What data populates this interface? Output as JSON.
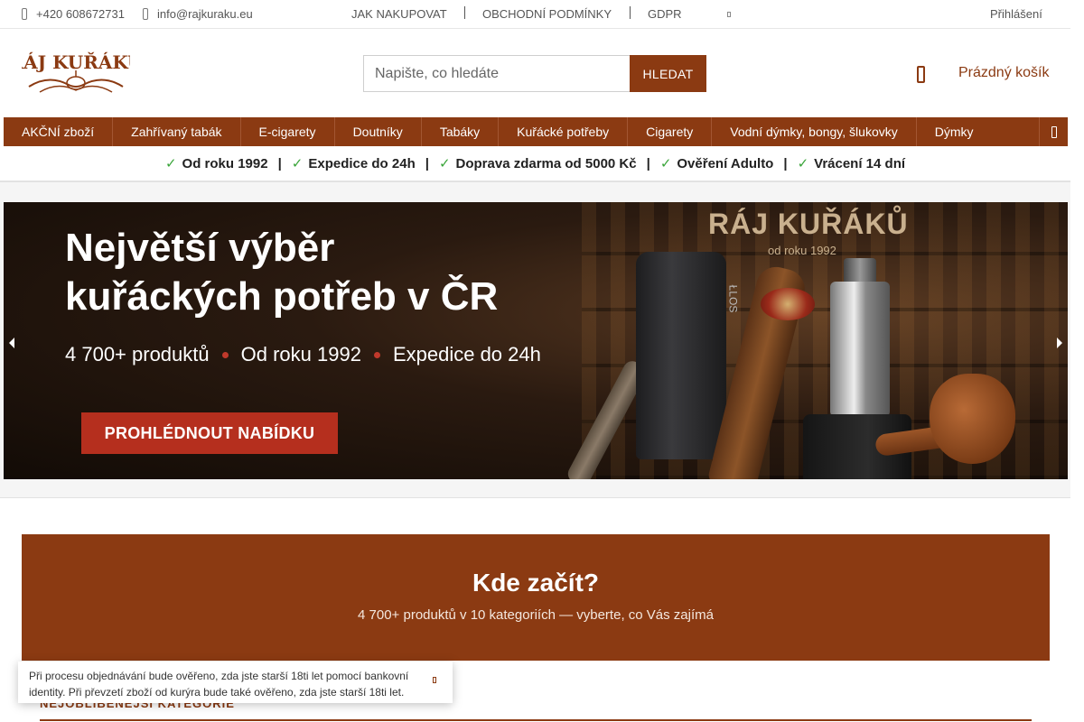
{
  "topbar": {
    "phone": "+420 608672731",
    "email": "info@rajkuraku.eu",
    "links": [
      "JAK NAKUPOVAT",
      "OBCHODNÍ PODMÍNKY",
      "GDPR"
    ],
    "login": "Přihlášení"
  },
  "logo": {
    "text": "RÁJ KUŘÁKŮ"
  },
  "search": {
    "placeholder": "Napište, co hledáte",
    "button": "HLEDAT"
  },
  "cart": {
    "label": "Prázdný košík"
  },
  "nav": {
    "items": [
      "AKČNÍ zboží",
      "Zahřívaný tabák",
      "E-cigarety",
      "Doutníky",
      "Tabáky",
      "Kuřácké potřeby",
      "Cigarety",
      "Vodní dýmky, bongy, šlukovky",
      "Dýmky"
    ]
  },
  "benefits": [
    "Od roku 1992",
    "Expedice do 24h",
    "Doprava zdarma od 5000 Kč",
    "Ověření Adulto",
    "Vrácení 14 dní"
  ],
  "banner": {
    "brand": "RÁJ KUŘÁKŮ",
    "since": "od roku 1992",
    "title_line1": "Největší výběr",
    "title_line2": "kuřáckých potřeb v ČR",
    "sub": [
      "4 700+ produktů",
      "Od roku 1992",
      "Expedice do 24h"
    ],
    "cta": "PROHLÉDNOUT NABÍDKU",
    "device_label": "ŁLOS"
  },
  "start": {
    "title": "Kde začít?",
    "subtitle": "4 700+ produktů v 10 kategoriích — vyberte, co Vás zajímá"
  },
  "section": {
    "title": "NEJOBLÍBENĚJŠÍ KATEGORIE"
  },
  "notice": {
    "text": "Při procesu objednávání bude ověřeno, zda jste starší 18ti let pomocí bankovní identity. Při převzetí zboží od kurýra bude také ověřeno, zda jste starší 18ti let."
  },
  "colors": {
    "brand": "#8b3a12",
    "check": "#3aa53a",
    "cta": "#b52f1e"
  }
}
